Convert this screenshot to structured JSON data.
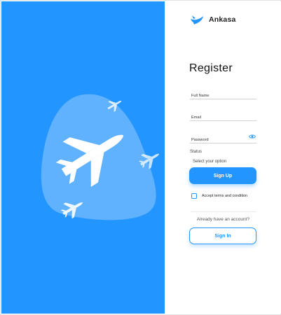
{
  "brand": {
    "name": "Ankasa",
    "logo_icon": "plane-logo-icon",
    "accent": "#2395ff"
  },
  "hero": {
    "background": "#2395ff",
    "illustration": "plane-illustration"
  },
  "form": {
    "title": "Register",
    "full_name": {
      "placeholder": "Full Name",
      "value": ""
    },
    "email": {
      "placeholder": "Email",
      "value": ""
    },
    "password": {
      "placeholder": "Password",
      "value": "",
      "toggle_icon": "eye-icon"
    },
    "status": {
      "label": "Status",
      "selected": "Select your option"
    },
    "sign_up_label": "Sign Up",
    "terms_label": "Accept terms and condition",
    "already_text": "Already have an account?",
    "sign_in_label": "Sign In"
  }
}
